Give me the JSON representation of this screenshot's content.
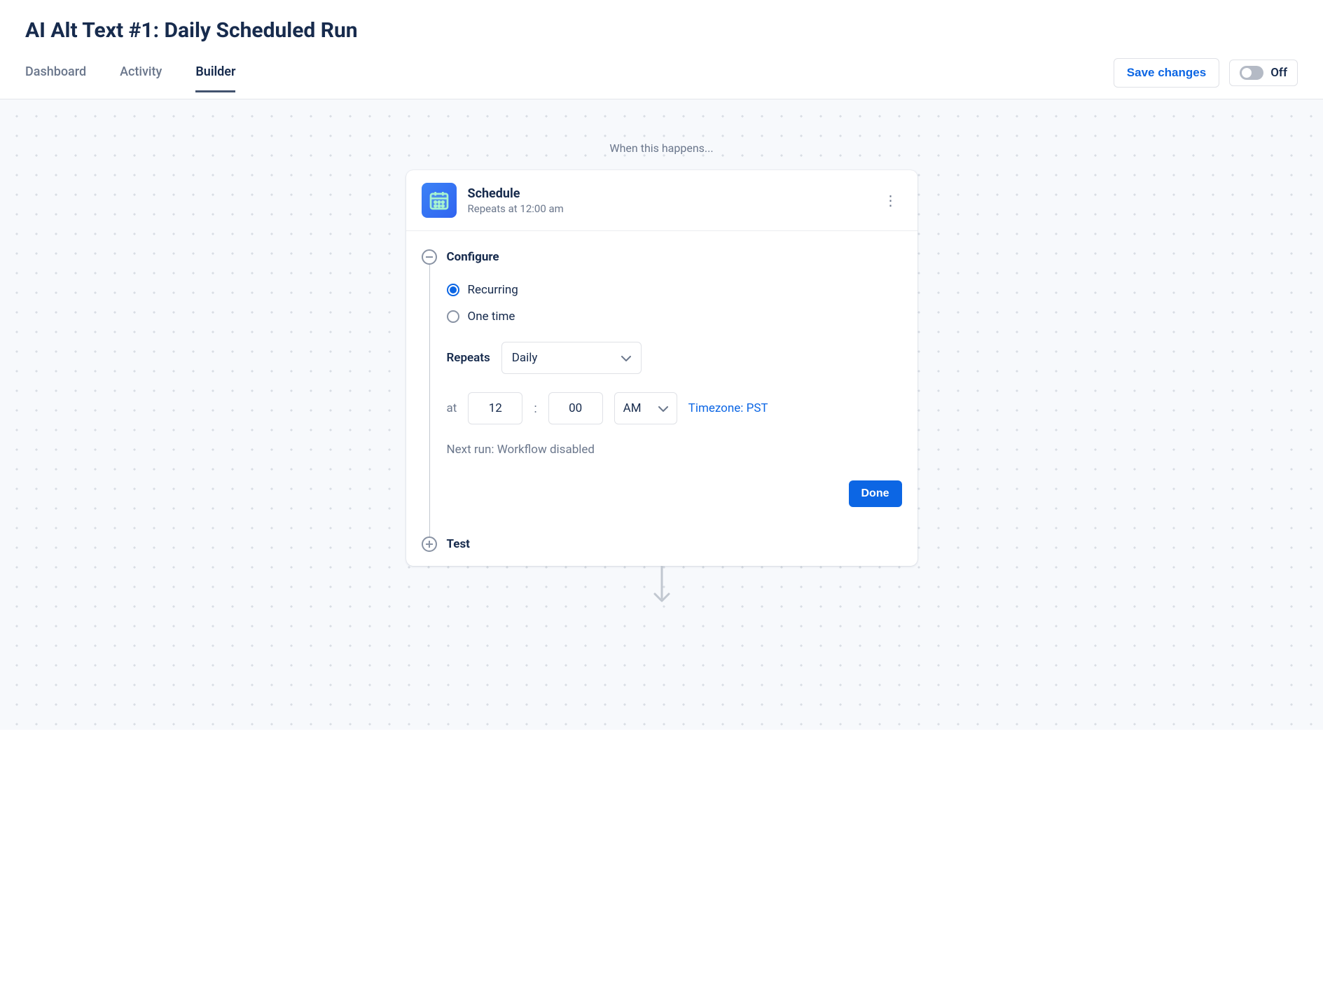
{
  "header": {
    "title": "AI Alt Text #1: Daily Scheduled Run",
    "tabs": {
      "dashboard": "Dashboard",
      "activity": "Activity",
      "builder": "Builder"
    },
    "save_label": "Save changes",
    "toggle_label": "Off"
  },
  "canvas": {
    "trigger_label": "When this happens..."
  },
  "card": {
    "title": "Schedule",
    "subtitle": "Repeats at 12:00 am"
  },
  "config": {
    "section_label": "Configure",
    "radio_recurring": "Recurring",
    "radio_onetime": "One time",
    "repeats_label": "Repeats",
    "repeats_value": "Daily",
    "at_label": "at",
    "hour": "12",
    "minute": "00",
    "ampm": "AM",
    "timezone_label": "Timezone: PST",
    "next_run": "Next run: Workflow disabled",
    "done_label": "Done"
  },
  "test": {
    "section_label": "Test"
  }
}
